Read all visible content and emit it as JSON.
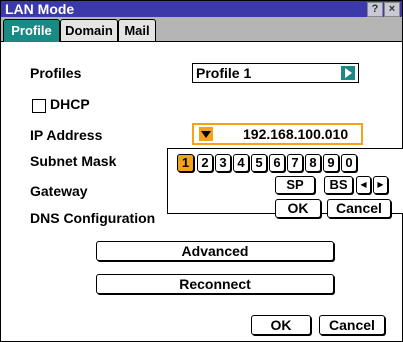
{
  "window": {
    "title": "LAN Mode",
    "help_label": "?",
    "close_label": "×"
  },
  "tabs": [
    {
      "label": "Profile",
      "active": true
    },
    {
      "label": "Domain",
      "active": false
    },
    {
      "label": "Mail",
      "active": false
    }
  ],
  "profiles": {
    "label": "Profiles",
    "value": "Profile 1",
    "arrow_icon": "triangle-right-icon"
  },
  "dhcp": {
    "label": "DHCP",
    "checked": false
  },
  "ip": {
    "label": "IP Address",
    "value": "192.168.100.010",
    "dropdown_icon": "triangle-down-icon"
  },
  "subnet": {
    "label": "Subnet Mask"
  },
  "gateway": {
    "label": "Gateway"
  },
  "dns": {
    "label": "DNS Configuration"
  },
  "keyboard": {
    "digits": [
      "1",
      "2",
      "3",
      "4",
      "5",
      "6",
      "7",
      "8",
      "9",
      "0"
    ],
    "selected": "1",
    "sp": "SP",
    "bs": "BS",
    "left": "◀",
    "right": "▶",
    "ok": "OK",
    "cancel": "Cancel"
  },
  "buttons": {
    "advanced": "Advanced",
    "reconnect": "Reconnect",
    "ok": "OK",
    "cancel": "Cancel"
  },
  "colors": {
    "titlebar": "#3c3aa8",
    "active_tab": "#1a8a84",
    "tab_strip": "#b5b5b5",
    "accent": "#f5a21a"
  }
}
